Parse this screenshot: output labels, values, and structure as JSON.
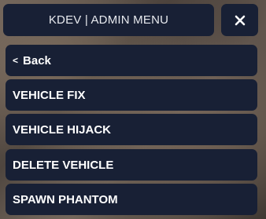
{
  "header": {
    "title": "KDEV | ADMIN MENU",
    "close_icon": "close-icon"
  },
  "menu": {
    "back": {
      "chevron": "<",
      "label": "Back"
    },
    "items": [
      {
        "label": "VEHICLE FIX"
      },
      {
        "label": "VEHICLE HIJACK"
      },
      {
        "label": "DELETE VEHICLE"
      },
      {
        "label": "SPAWN PHANTOM"
      }
    ]
  },
  "colors": {
    "panel": "#182035",
    "text": "#ffffff",
    "title_text": "#e7e9ee"
  }
}
